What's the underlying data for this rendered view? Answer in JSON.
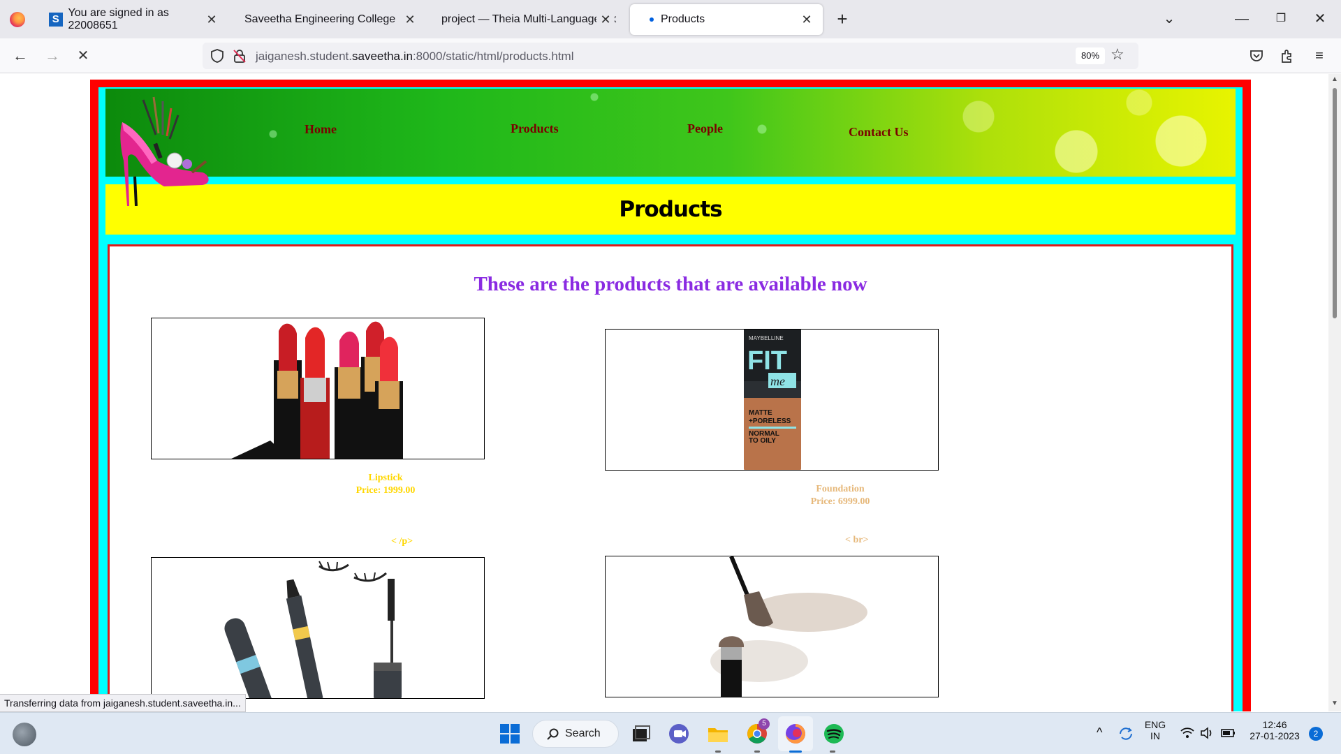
{
  "browser": {
    "tabs": [
      {
        "label": "You are signed in as 22008651",
        "active": false
      },
      {
        "label": "Saveetha Engineering College",
        "active": false
      },
      {
        "label": "project — Theia Multi-Language Ex",
        "active": false
      },
      {
        "label": "Products",
        "active": true
      }
    ],
    "url_prefix": "jaiganesh.student.",
    "url_domain": "saveetha.in",
    "url_suffix": ":8000/static/html/products.html",
    "zoom": "80%",
    "status_text": "Transferring data from jaiganesh.student.saveetha.in..."
  },
  "page": {
    "nav": [
      "Home",
      "Products",
      "People",
      "Contact Us"
    ],
    "title": "Products",
    "headline": "These are the products that are available now",
    "products": [
      {
        "name": "Lipstick",
        "price": "Price: 1999.00",
        "color": "#ffd700"
      },
      {
        "name": "Foundation",
        "price": "Price: 6999.00",
        "color": "#e6b87a"
      }
    ],
    "stray_tags": [
      "< /p>",
      "< br>"
    ],
    "stray_colors": [
      "#ffd700",
      "#e6b87a"
    ]
  },
  "taskbar": {
    "search_label": "Search",
    "lang_top": "ENG",
    "lang_bottom": "IN",
    "time": "12:46",
    "date": "27-01-2023",
    "notification_count": "2",
    "chrome_badge": "5"
  }
}
